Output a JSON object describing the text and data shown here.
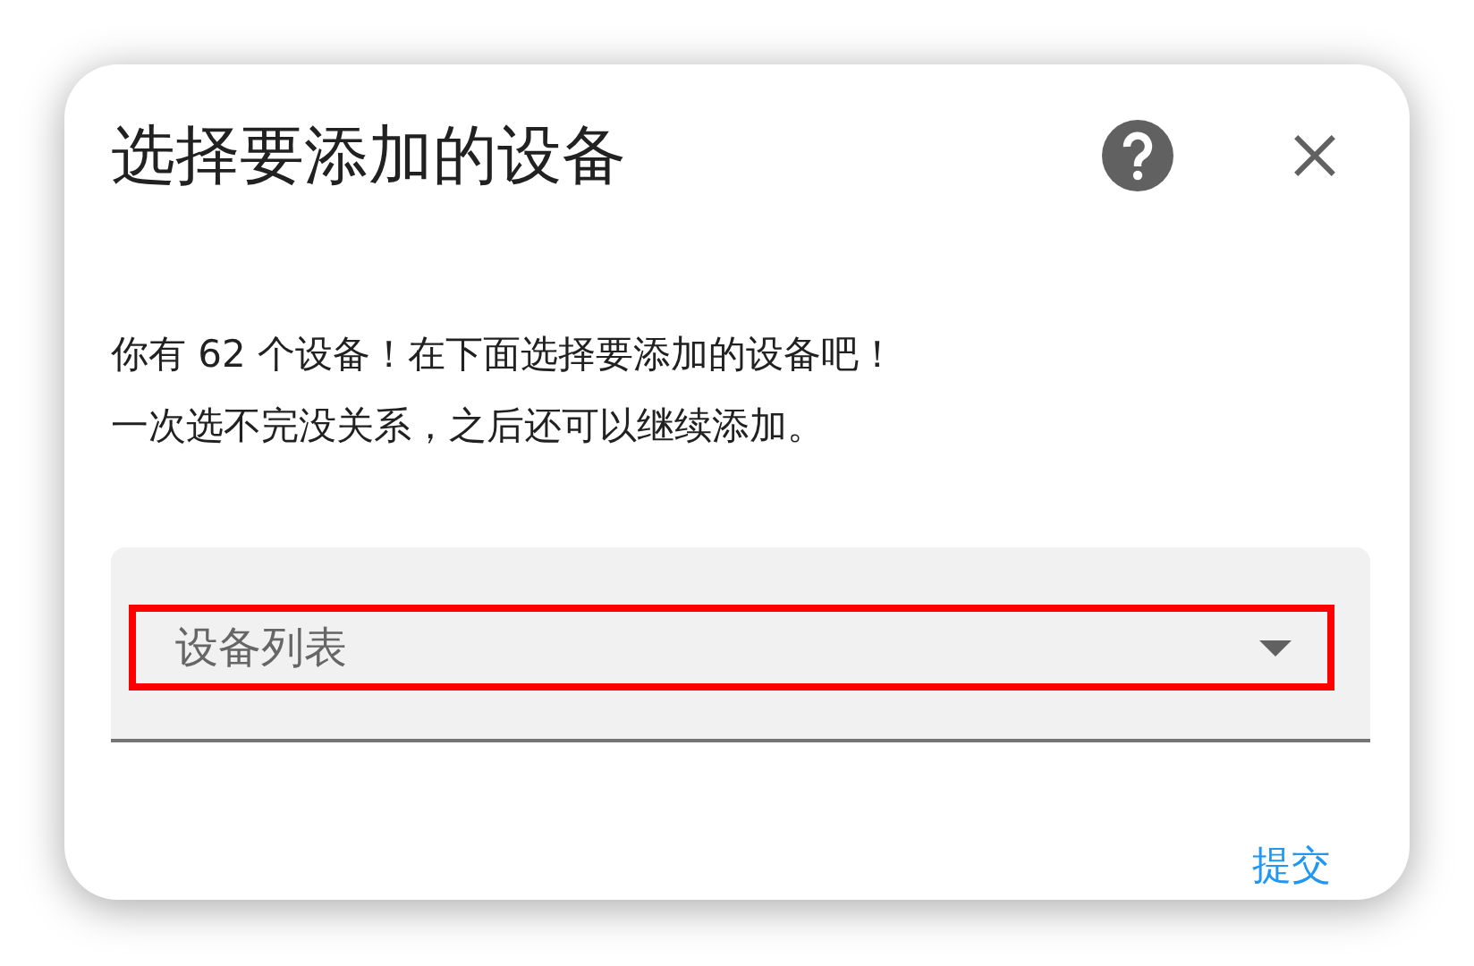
{
  "dialog": {
    "title": "选择要添加的设备",
    "description": [
      "你有 62 个设备！在下面选择要添加的设备吧！",
      "一次选不完没关系，之后还可以继续添加。"
    ],
    "dropdown": {
      "placeholder": "设备列表",
      "highlighted": true
    },
    "buttons": [
      "提交"
    ]
  }
}
